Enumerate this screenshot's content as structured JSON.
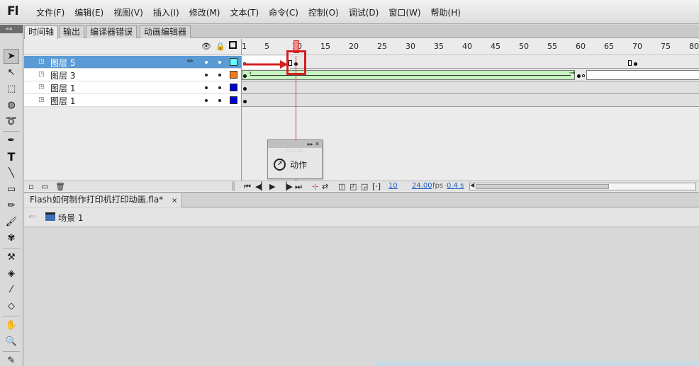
{
  "app": {
    "logo": "Fl"
  },
  "menu": [
    "文件(F)",
    "编辑(E)",
    "视图(V)",
    "插入(I)",
    "修改(M)",
    "文本(T)",
    "命令(C)",
    "控制(O)",
    "调试(D)",
    "窗口(W)",
    "帮助(H)"
  ],
  "toolbar": {
    "collapse_label": "««"
  },
  "panel_tabs": [
    "时间轴",
    "输出",
    "编译器错误",
    "动画编辑器"
  ],
  "ruler": [
    "1",
    "5",
    "10",
    "15",
    "20",
    "25",
    "30",
    "35",
    "40",
    "45",
    "50",
    "55",
    "60",
    "65",
    "70",
    "75",
    "80"
  ],
  "layers": [
    {
      "name": "图层 5",
      "color": "#66ffff",
      "selected": true
    },
    {
      "name": "图层 3",
      "color": "#f07c1e",
      "selected": false
    },
    {
      "name": "图层 1",
      "color": "#0000cc",
      "selected": false
    },
    {
      "name": "图层 1",
      "color": "#0000cc",
      "selected": false
    }
  ],
  "actions_panel": {
    "label": "动作",
    "header": "▸▸ ✕"
  },
  "timeline_status": {
    "frame": "10",
    "fps_value": "24.00",
    "fps_unit": "fps",
    "time": "0.4 s"
  },
  "document": {
    "tab": "Flash如何制作打印机打印动画.fla*",
    "close": "×",
    "scene": "场景 1"
  },
  "colors": {
    "selected_layer": "#5a9bd5",
    "tween": "#c6f2c0",
    "highlight": "#d42020"
  }
}
